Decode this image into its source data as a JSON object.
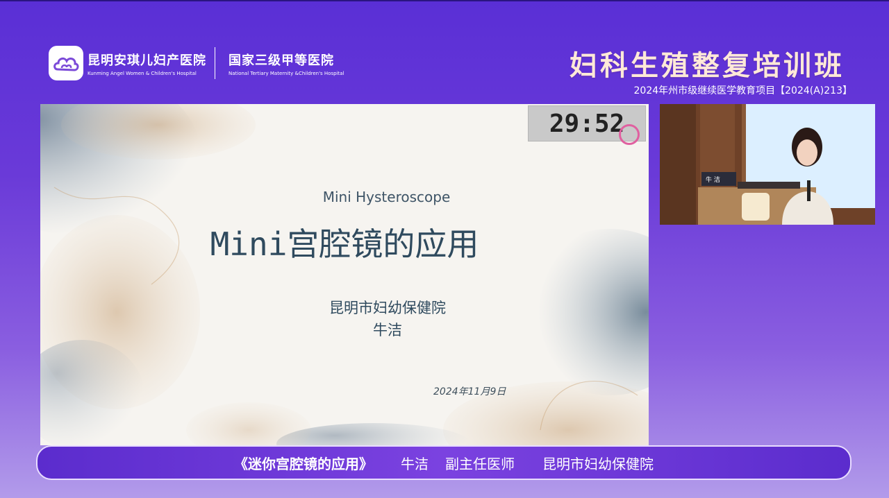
{
  "hospital": {
    "name_cn": "昆明安琪儿妇产医院",
    "name_en": "Kunming Angel Women & Children's Hospital",
    "grade_cn": "国家三级甲等医院",
    "grade_en": "National Tertiary Maternity &Children's Hospital",
    "logo_icon": "cloud-logo-icon"
  },
  "header": {
    "title": "妇科生殖整复培训班",
    "subtitle": "2024年州市级继续医学教育项目【2024(A)213】"
  },
  "slide": {
    "subtitle_en": "Mini Hysteroscope",
    "title": "Mini宫腔镜的应用",
    "organization": "昆明市妇幼保健院",
    "presenter": "牛洁",
    "date": "2024年11月9日",
    "timer": "29:52"
  },
  "camera": {
    "nameplate": "牛 洁"
  },
  "caption": {
    "talk_title": "《迷你宫腔镜的应用》",
    "speaker": "牛洁",
    "role": "副主任医师",
    "institution": "昆明市妇幼保健院"
  },
  "colors": {
    "background_top": "#5a2fd6",
    "background_bottom": "#b29bea",
    "title_color": "#ffe9d8",
    "slide_text": "#2f4a5e"
  }
}
